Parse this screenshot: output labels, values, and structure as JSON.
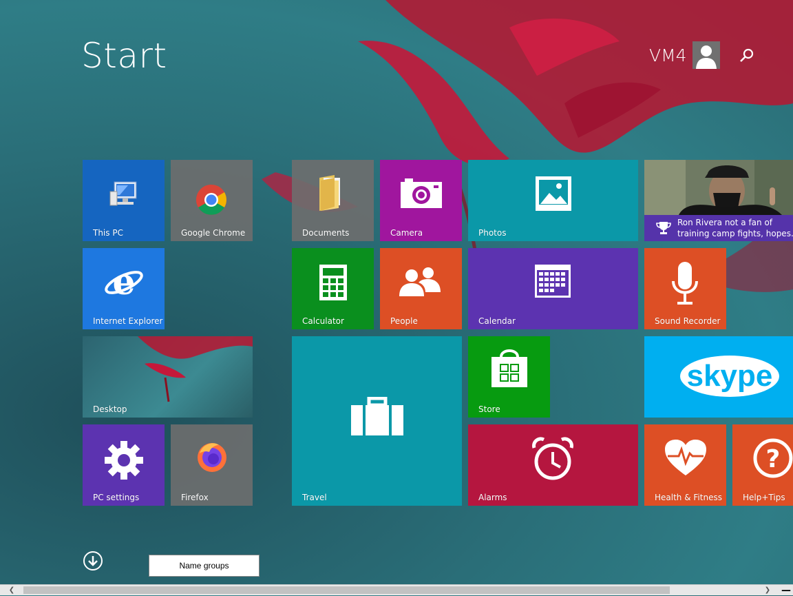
{
  "header": {
    "title": "Start",
    "user_name": "VM4"
  },
  "tiles": {
    "this_pc": "This PC",
    "chrome": "Google Chrome",
    "documents": "Documents",
    "camera": "Camera",
    "photos": "Photos",
    "ie": "Internet Explorer",
    "calculator": "Calculator",
    "people": "People",
    "calendar": "Calendar",
    "sound_recorder": "Sound Recorder",
    "desktop": "Desktop",
    "travel": "Travel",
    "store": "Store",
    "skype": "skype",
    "pc_settings": "PC settings",
    "firefox": "Firefox",
    "alarms": "Alarms",
    "health": "Health & Fitness",
    "help": "Help+Tips",
    "news_line1": "Ron Rivera not a fan of",
    "news_line2": "training camp fights, hopes..."
  },
  "footer": {
    "name_groups": "Name groups"
  },
  "colors": {
    "blue": "#1565c0",
    "gray": "#5f6a6b",
    "magenta": "#a0169e",
    "teal": "#0b98a8",
    "green": "#0a8f1e",
    "orange": "#dd4f25",
    "purple": "#5c33b0",
    "crimson": "#b5163f",
    "skype": "#00aff0",
    "store": "#079b10"
  },
  "icons": [
    "computer-icon",
    "chrome-icon",
    "folder-icon",
    "camera-icon",
    "photos-icon",
    "ie-icon",
    "calculator-icon",
    "people-icon",
    "calendar-icon",
    "microphone-icon",
    "suitcase-icon",
    "store-bag-icon",
    "skype-icon",
    "gear-icon",
    "firefox-icon",
    "alarm-clock-icon",
    "heart-pulse-icon",
    "help-icon",
    "trophy-icon",
    "user-icon",
    "search-icon",
    "down-arrow-icon"
  ]
}
